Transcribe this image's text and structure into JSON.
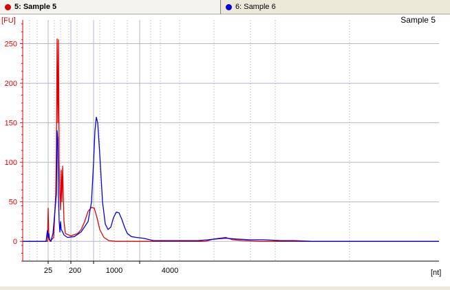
{
  "tabs": [
    {
      "label": "5: Sample 5",
      "color": "#e00000"
    },
    {
      "label": "6: Sample 6",
      "color": "#0000e0"
    }
  ],
  "chart_data": {
    "type": "line",
    "title": "Sample 5",
    "ylabel": "[FU]",
    "xlabel": "[nt]",
    "ylim": [
      -25,
      280
    ],
    "yticks": [
      0,
      50,
      100,
      150,
      200,
      250
    ],
    "xtick_labels": [
      "25",
      "200",
      "1000",
      "4000"
    ],
    "grid": true,
    "series": [
      {
        "name": "Sample 5",
        "color": "#e00000",
        "points": [
          [
            0,
            0
          ],
          [
            30,
            0
          ],
          [
            36,
            0
          ],
          [
            37,
            42
          ],
          [
            38,
            3
          ],
          [
            40,
            0
          ],
          [
            45,
            5
          ],
          [
            48,
            60
          ],
          [
            49,
            120
          ],
          [
            50,
            256
          ],
          [
            51,
            150
          ],
          [
            52,
            255
          ],
          [
            53,
            100
          ],
          [
            54,
            60
          ],
          [
            55,
            40
          ],
          [
            56,
            90
          ],
          [
            57,
            50
          ],
          [
            58,
            95
          ],
          [
            59,
            60
          ],
          [
            60,
            25
          ],
          [
            62,
            10
          ],
          [
            70,
            7
          ],
          [
            80,
            10
          ],
          [
            85,
            15
          ],
          [
            90,
            25
          ],
          [
            95,
            38
          ],
          [
            100,
            43
          ],
          [
            104,
            42
          ],
          [
            108,
            30
          ],
          [
            112,
            15
          ],
          [
            118,
            5
          ],
          [
            125,
            1
          ],
          [
            135,
            0
          ],
          [
            170,
            0
          ],
          [
            220,
            0
          ],
          [
            265,
            0
          ],
          [
            278,
            3
          ],
          [
            295,
            5
          ],
          [
            305,
            2
          ],
          [
            320,
            1
          ],
          [
            345,
            0
          ],
          [
            460,
            0
          ],
          [
            560,
            0
          ],
          [
            605,
            0
          ]
        ]
      },
      {
        "name": "Sample 6",
        "color": "#0000e0",
        "points": [
          [
            0,
            0
          ],
          [
            34,
            0
          ],
          [
            35,
            8
          ],
          [
            36,
            14
          ],
          [
            37,
            5
          ],
          [
            38,
            10
          ],
          [
            39,
            3
          ],
          [
            41,
            0
          ],
          [
            44,
            10
          ],
          [
            47,
            40
          ],
          [
            49,
            60
          ],
          [
            50,
            140
          ],
          [
            51,
            130
          ],
          [
            52,
            55
          ],
          [
            53,
            25
          ],
          [
            54,
            12
          ],
          [
            55,
            25
          ],
          [
            56,
            15
          ],
          [
            58,
            12
          ],
          [
            60,
            8
          ],
          [
            65,
            5
          ],
          [
            75,
            6
          ],
          [
            85,
            12
          ],
          [
            95,
            25
          ],
          [
            100,
            50
          ],
          [
            103,
            100
          ],
          [
            105,
            140
          ],
          [
            107,
            157
          ],
          [
            109,
            150
          ],
          [
            112,
            110
          ],
          [
            116,
            50
          ],
          [
            120,
            22
          ],
          [
            124,
            15
          ],
          [
            128,
            18
          ],
          [
            132,
            30
          ],
          [
            136,
            37
          ],
          [
            140,
            36
          ],
          [
            144,
            28
          ],
          [
            148,
            18
          ],
          [
            152,
            10
          ],
          [
            158,
            6
          ],
          [
            165,
            5
          ],
          [
            175,
            4
          ],
          [
            180,
            3
          ],
          [
            190,
            1
          ],
          [
            220,
            1
          ],
          [
            240,
            1
          ],
          [
            255,
            1
          ],
          [
            270,
            2
          ],
          [
            280,
            3
          ],
          [
            295,
            4
          ],
          [
            310,
            3
          ],
          [
            330,
            2
          ],
          [
            350,
            2
          ],
          [
            375,
            1
          ],
          [
            395,
            1
          ],
          [
            420,
            0
          ],
          [
            460,
            0
          ],
          [
            520,
            0
          ],
          [
            560,
            0
          ],
          [
            605,
            0
          ]
        ]
      }
    ]
  }
}
